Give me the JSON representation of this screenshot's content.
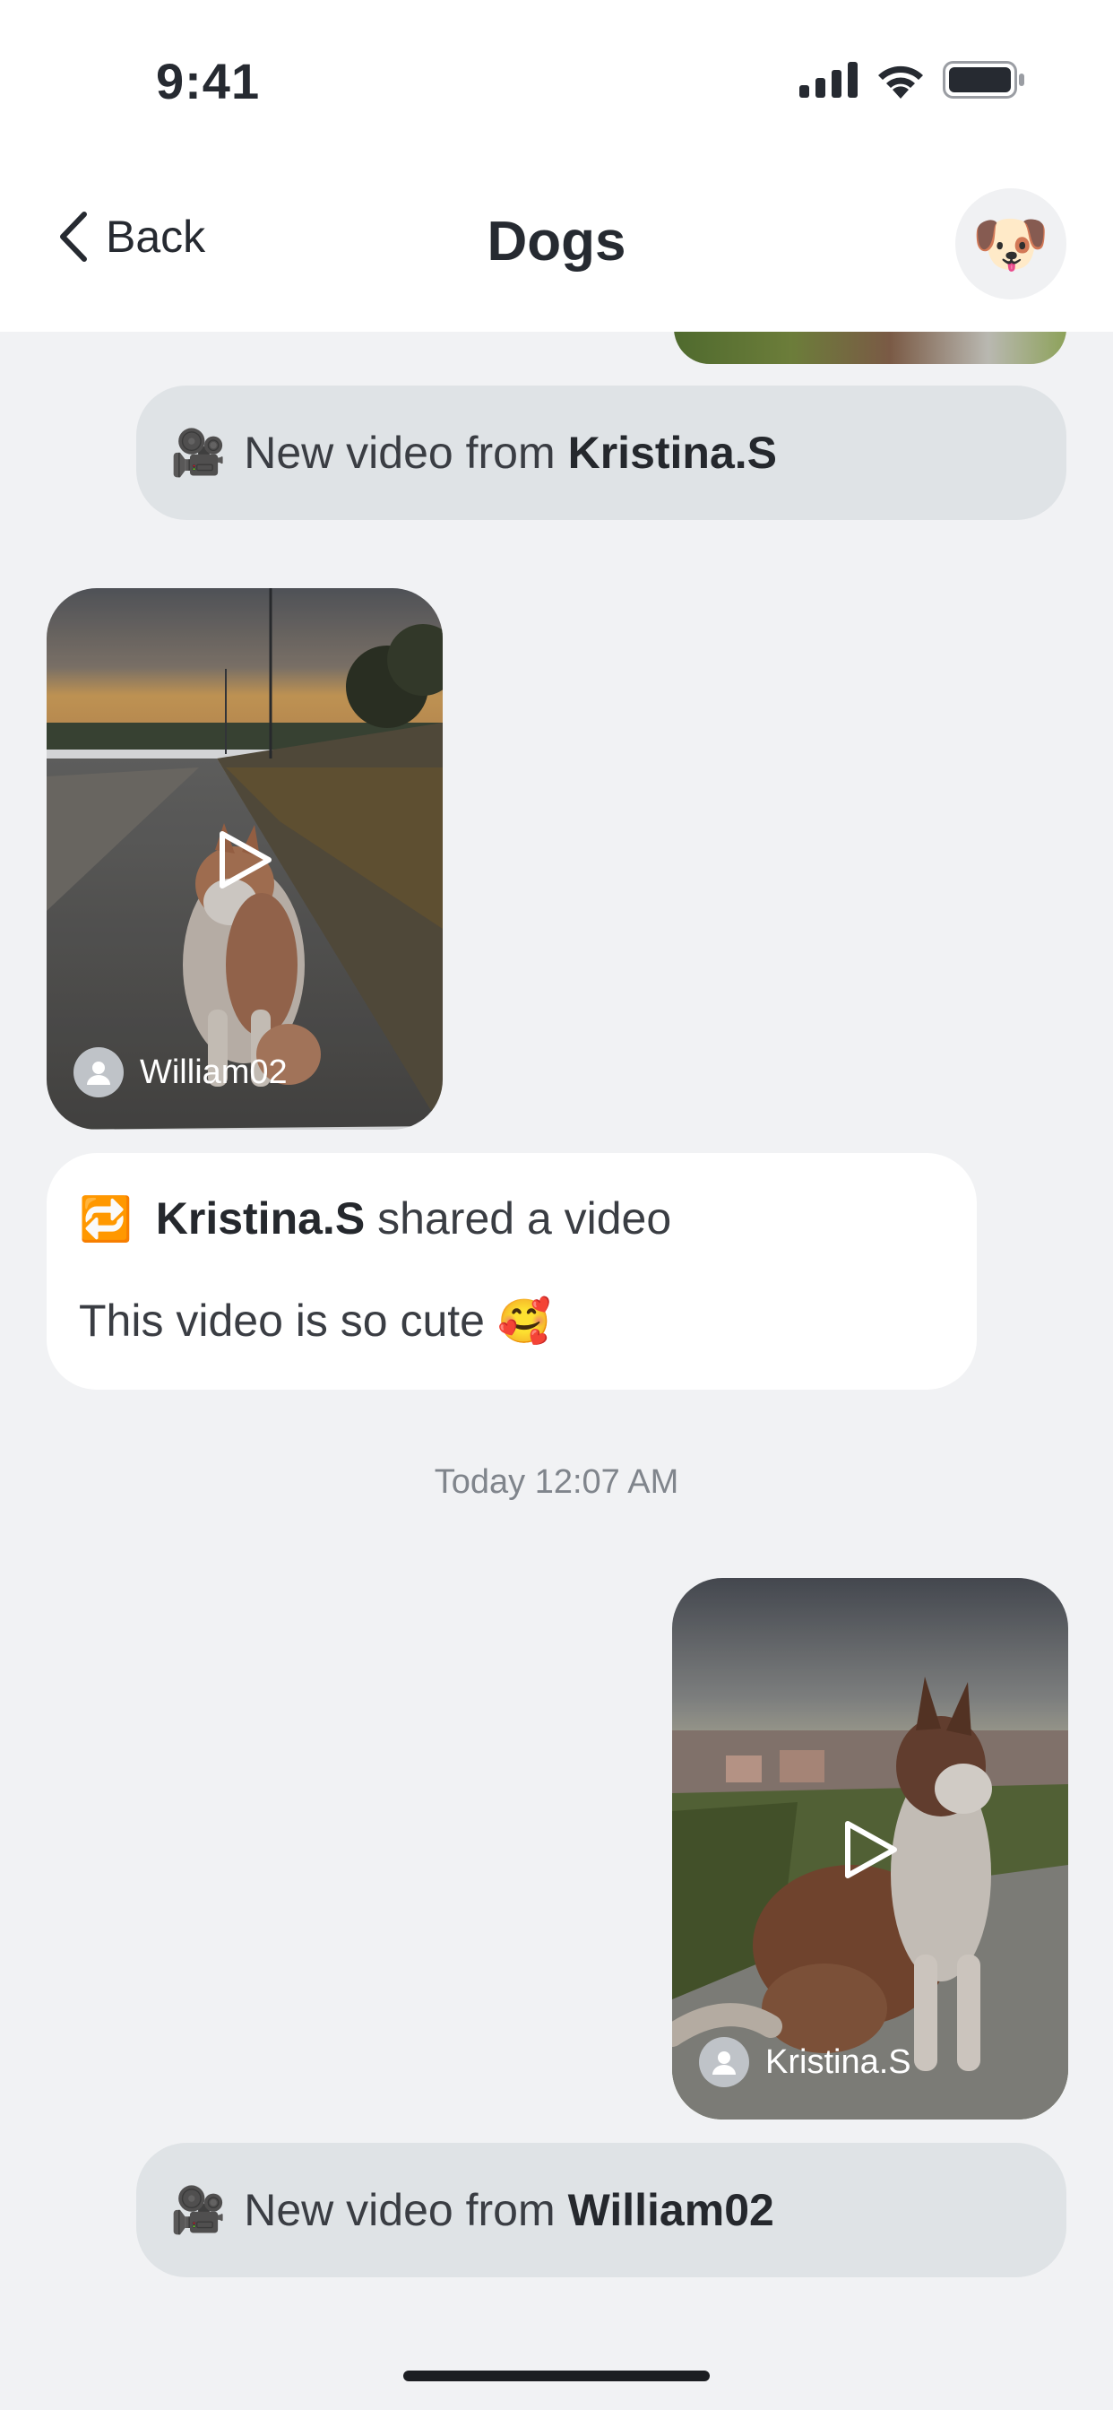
{
  "status_bar": {
    "time": "9:41",
    "icons": [
      "signal-icon",
      "wifi-icon",
      "battery-icon"
    ]
  },
  "nav": {
    "back_label": "Back",
    "title": "Dogs",
    "avatar_emoji": "🐶"
  },
  "messages": [
    {
      "type": "notice",
      "icon": "🎥",
      "text": "New video from",
      "name": "Kristina.S"
    },
    {
      "type": "video",
      "author": "William02"
    },
    {
      "type": "share",
      "icon": "🔁",
      "name": "Kristina.S",
      "action": "shared a video",
      "message": "This video is so cute",
      "emoji": "🥰"
    },
    {
      "type": "timestamp",
      "text": "Today 12:07 AM"
    },
    {
      "type": "video",
      "author": "Kristina.S"
    },
    {
      "type": "notice",
      "icon": "🎥",
      "text": "New video from",
      "name": "William02"
    }
  ],
  "colors": {
    "background": "#f1f2f4",
    "notice_pill": "#dfe3e6",
    "card": "#ffffff",
    "timestamp": "#80858c"
  }
}
